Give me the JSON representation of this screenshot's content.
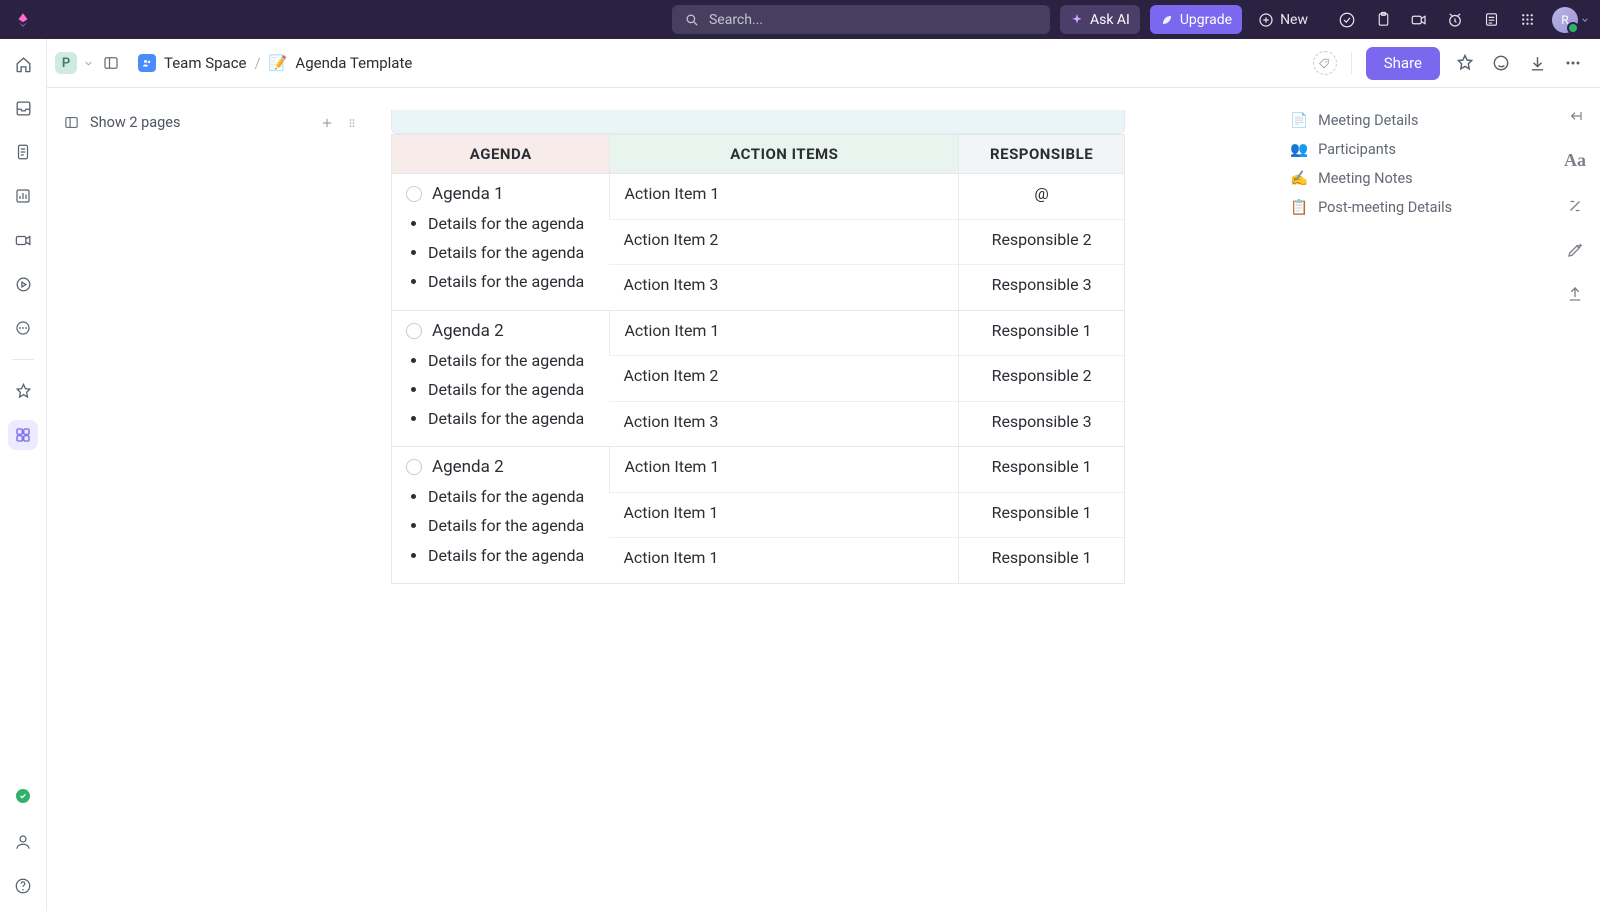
{
  "top": {
    "search_placeholder": "Search...",
    "ask_ai": "Ask AI",
    "upgrade": "Upgrade",
    "new": "New",
    "avatar_initial": "R"
  },
  "breadcrumb": {
    "workspace_initial": "P",
    "space_name": "Team Space",
    "doc_emoji": "📝",
    "doc_name": "Agenda Template"
  },
  "subbar": {
    "share": "Share"
  },
  "pages_bar": {
    "label": "Show 2 pages"
  },
  "table": {
    "headers": {
      "agenda": "AGENDA",
      "actions": "ACTION ITEMS",
      "responsible": "RESPONSIBLE"
    },
    "rows": [
      {
        "title": "Agenda 1",
        "details": [
          "Details for the agen­da",
          "Details for the agen­da",
          "Details for the agen­da"
        ],
        "actions": [
          {
            "item": "Action Item 1",
            "resp": "@"
          },
          {
            "item": "Action Item 2",
            "resp": "Responsible 2"
          },
          {
            "item": "Action Item 3",
            "resp": "Responsible 3"
          }
        ]
      },
      {
        "title": "Agenda 2",
        "details": [
          "Details for the agen­da",
          "Details for the agen­da",
          "Details for the agen­da"
        ],
        "actions": [
          {
            "item": "Action Item 1",
            "resp": "Responsible 1"
          },
          {
            "item": "Action Item 2",
            "resp": "Responsible 2"
          },
          {
            "item": "Action Item 3",
            "resp": "Responsible 3"
          }
        ]
      },
      {
        "title": "Agenda 2",
        "details": [
          "Details for the agen­da",
          "Details for the agen­da",
          "Details for the agen­da"
        ],
        "actions": [
          {
            "item": "Action Item 1",
            "resp": "Responsible 1"
          },
          {
            "item": "Action Item 1",
            "resp": "Responsible 1"
          },
          {
            "item": "Action Item 1",
            "resp": "Responsible 1"
          }
        ]
      }
    ]
  },
  "outline": {
    "items": [
      {
        "emoji": "📄",
        "label": "Meeting Details"
      },
      {
        "emoji": "👥",
        "label": "Participants"
      },
      {
        "emoji": "✍️",
        "label": "Meeting Notes"
      },
      {
        "emoji": "📋",
        "label": "Post-meeting Details"
      }
    ]
  }
}
